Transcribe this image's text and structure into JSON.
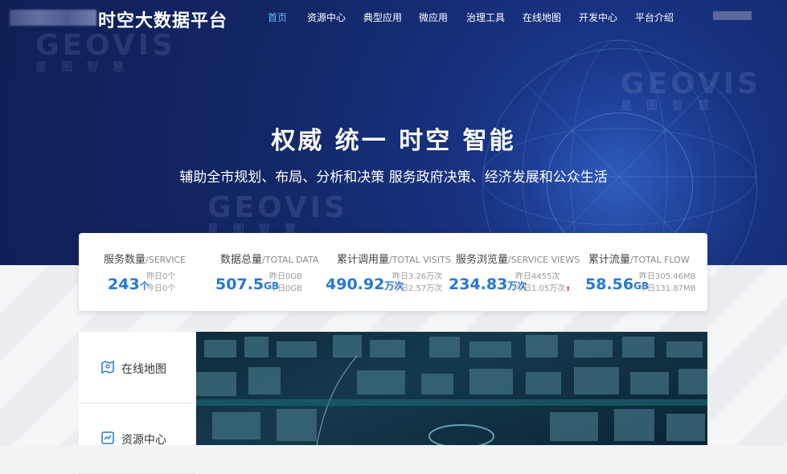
{
  "header": {
    "title": "时空大数据平台",
    "nav": [
      "首页",
      "资源中心",
      "典型应用",
      "微应用",
      "治理工具",
      "在线地图",
      "开发中心",
      "平台介绍"
    ],
    "active_index": 0
  },
  "hero": {
    "slogan": "权威  统一  时空  智能",
    "subslogan": "辅助全市规划、布局、分析和决策    服务政府决策、经济发展和公众生活",
    "watermark": "GEOVIS",
    "watermark_sub": "星图智慧",
    "slides": 3,
    "active_slide": 0
  },
  "stats": [
    {
      "title": "服务数量",
      "en": "/SERVICE",
      "value": "243",
      "unit": "个",
      "yesterday": "昨日0个",
      "today": "今日0个",
      "up": false
    },
    {
      "title": "数据总量",
      "en": "/TOTAL DATA",
      "value": "507.5",
      "unit": "GB",
      "yesterday": "昨日0GB",
      "today": "今日0GB",
      "up": false
    },
    {
      "title": "累计调用量",
      "en": "/TOTAL VISITS",
      "value": "490.92",
      "unit": "万次",
      "yesterday": "昨日3.26万次",
      "today": "今日2.57万次",
      "up": false
    },
    {
      "title": "服务浏览量",
      "en": "/SERVICE VIEWS",
      "value": "234.83",
      "unit": "万次",
      "yesterday": "昨日4455次",
      "today": "今日1.05万次",
      "up": true
    },
    {
      "title": "累计流量",
      "en": "/TOTAL FLOW",
      "value": "58.56",
      "unit": "GB",
      "yesterday": "昨日305.46MB",
      "today": "今日131.87MB",
      "up": false
    }
  ],
  "sidebar": {
    "items": [
      {
        "label": "在线地图",
        "icon": "map-icon"
      },
      {
        "label": "资源中心",
        "icon": "resource-icon"
      }
    ]
  },
  "colors": {
    "accent": "#2577d8",
    "nav_active": "#5fc3ff",
    "hero_bg": "#132766"
  }
}
